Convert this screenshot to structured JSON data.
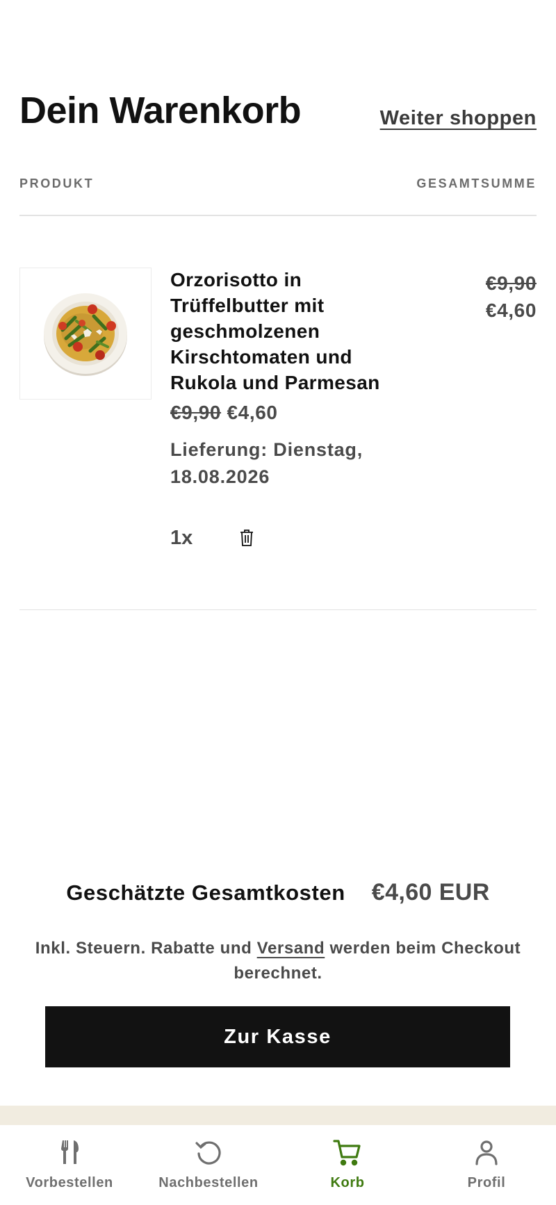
{
  "header": {
    "title": "Dein Warenkorb",
    "continue_link": "Weiter shoppen"
  },
  "table": {
    "col_product": "PRODUKT",
    "col_total": "GESAMTSUMME"
  },
  "item": {
    "name": "Orzorisotto in Trüffelbutter mit geschmolzenen Kirschtomaten und Rukola und Parmesan",
    "price_old": "€9,90",
    "price_new": "€4,60",
    "delivery": "Lieferung: Dienstag, 18.08.2026",
    "quantity": "1x",
    "total_old": "€9,90",
    "total_new": "€4,60"
  },
  "summary": {
    "estimated_label": "Geschätzte Gesamtkosten",
    "estimated_value": "€4,60 EUR",
    "tax_note_before": "Inkl. Steuern. Rabatte und ",
    "tax_note_link": "Versand",
    "tax_note_after": " werden beim Checkout berechnet.",
    "checkout_label": "Zur Kasse"
  },
  "tabbar": {
    "active_color": "#3f7a10",
    "inactive_color": "#6f6f6f",
    "items": [
      {
        "label": "Vorbestellen",
        "icon": "cutlery-icon",
        "active": false
      },
      {
        "label": "Nachbestellen",
        "icon": "reorder-icon",
        "active": false
      },
      {
        "label": "Korb",
        "icon": "cart-icon",
        "active": true
      },
      {
        "label": "Profil",
        "icon": "profile-icon",
        "active": false
      }
    ]
  }
}
